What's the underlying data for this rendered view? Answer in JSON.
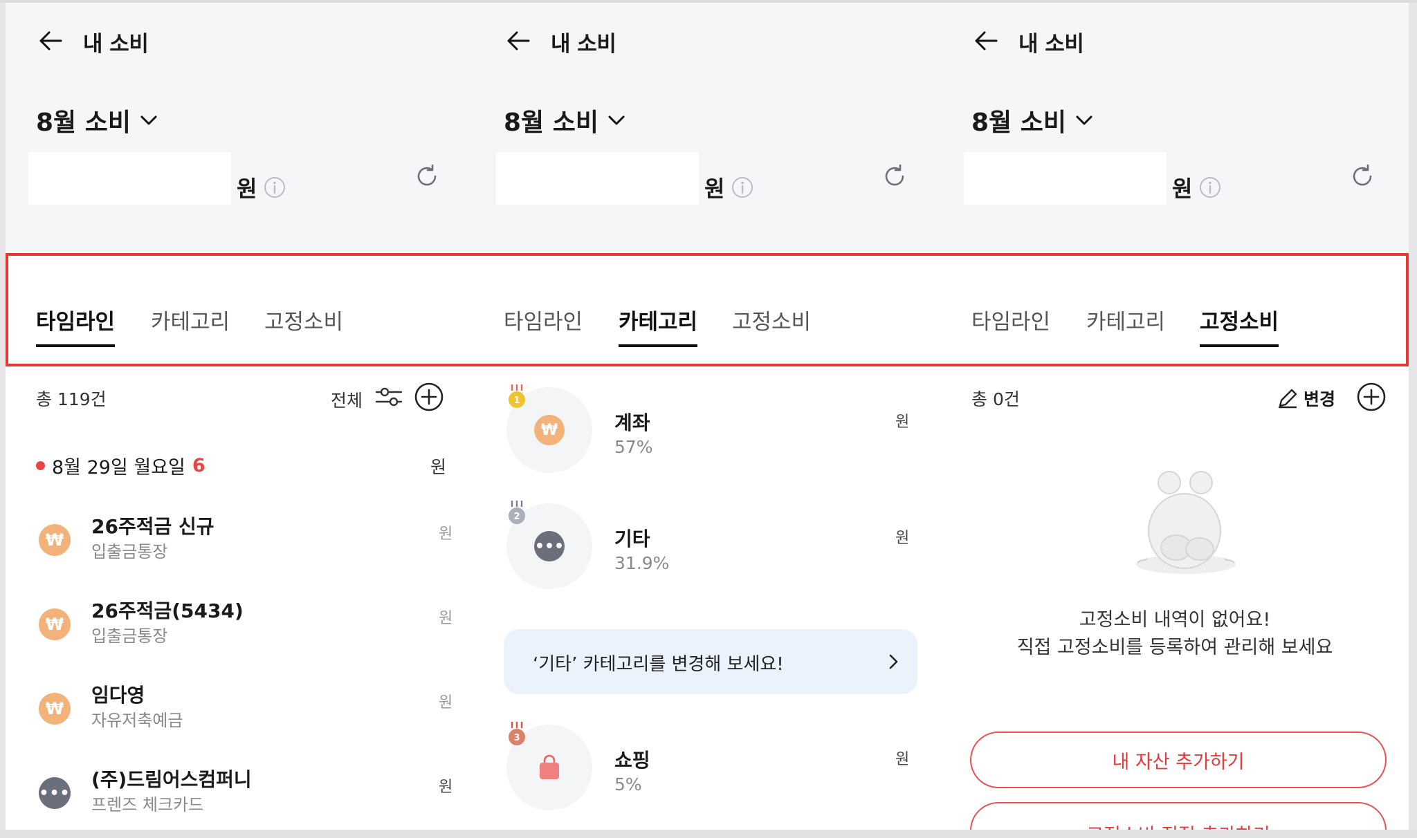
{
  "header": {
    "title": "내 소비",
    "month_label": "8월 소비",
    "currency": "원"
  },
  "tabs": [
    "타임라인",
    "카테고리",
    "고정소비"
  ],
  "timeline": {
    "total": "총 119건",
    "filter_label": "전체",
    "date": "8월 29일 월요일",
    "date_count": "6",
    "date_won": "원",
    "transactions": [
      {
        "name": "26주적금 신규",
        "sub": "입출금통장",
        "won": "원",
        "icon": "won-coin-icon"
      },
      {
        "name": "26주적금(5434)",
        "sub": "입출금통장",
        "won": "원",
        "icon": "won-coin-icon"
      },
      {
        "name": "임다영",
        "sub": "자유저축예금",
        "won": "원",
        "icon": "won-coin-icon"
      },
      {
        "name": "(주)드림어스컴퍼니",
        "sub": "프렌즈 체크카드",
        "won": "원",
        "icon": "more-dots-icon"
      }
    ]
  },
  "category": {
    "items": [
      {
        "rank": "1",
        "name": "계좌",
        "pct": "57%",
        "won": "원",
        "icon": "won-coin-icon",
        "medal_color": "#f0c330",
        "icon_color": "#f3b27a"
      },
      {
        "rank": "2",
        "name": "기타",
        "pct": "31.9%",
        "won": "원",
        "icon": "more-dots-icon",
        "medal_color": "#a9afbb",
        "icon_color": "#6b6f7b"
      },
      {
        "rank": "3",
        "name": "쇼핑",
        "pct": "5%",
        "won": "원",
        "icon": "shopping-bag-icon",
        "medal_color": "#d9826a",
        "icon_color": "#f08080"
      }
    ],
    "banner": "‘기타’ 카테고리를 변경해 보세요!"
  },
  "fixed": {
    "total": "총 0건",
    "edit_label": "변경",
    "empty_line1": "고정소비 내역이 없어요!",
    "empty_line2": "직접 고정소비를 등록하여 관리해 보세요",
    "btn_add_asset": "내 자산 추가하기",
    "btn_add_fixed": "고정소비 직접 추가하기"
  },
  "colors": {
    "accent_red": "#e53830",
    "coin": "#f3b27a",
    "banner_bg": "#eaf2fb"
  }
}
